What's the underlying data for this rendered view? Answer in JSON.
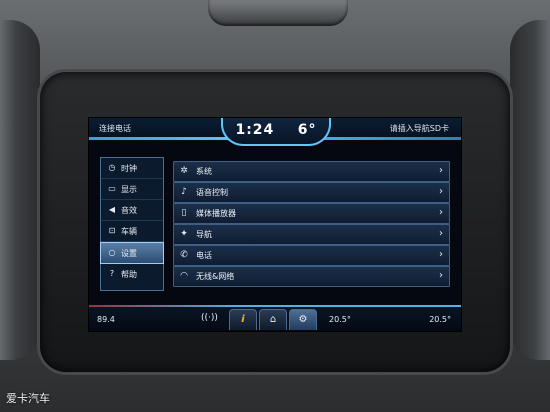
{
  "topbar": {
    "left_text": "连接电话",
    "time": "1:24",
    "temperature": "6°",
    "right_text": "请插入导航SD卡"
  },
  "sidebar": {
    "items": [
      {
        "label": "时钟",
        "icon": "clock-icon",
        "active": false
      },
      {
        "label": "显示",
        "icon": "display-icon",
        "active": false
      },
      {
        "label": "音效",
        "icon": "speaker-icon",
        "active": false
      },
      {
        "label": "车辆",
        "icon": "car-icon",
        "active": false
      },
      {
        "label": "设置",
        "icon": "settings-icon",
        "active": true
      },
      {
        "label": "帮助",
        "icon": "help-icon",
        "active": false
      }
    ]
  },
  "menu": {
    "items": [
      {
        "label": "系统",
        "icon": "gear-icon"
      },
      {
        "label": "语音控制",
        "icon": "voice-icon"
      },
      {
        "label": "媒体播放器",
        "icon": "media-player-icon"
      },
      {
        "label": "导航",
        "icon": "navigation-icon"
      },
      {
        "label": "电话",
        "icon": "phone-icon"
      },
      {
        "label": "无线&网络",
        "icon": "wifi-icon"
      }
    ]
  },
  "bottombar": {
    "radio": "89.4",
    "temp_left": "20.5°",
    "temp_right": "20.5°"
  },
  "watermark": "爱卡汽车",
  "colors": {
    "accent": "#5fc6f5",
    "info": "#f2b632"
  }
}
